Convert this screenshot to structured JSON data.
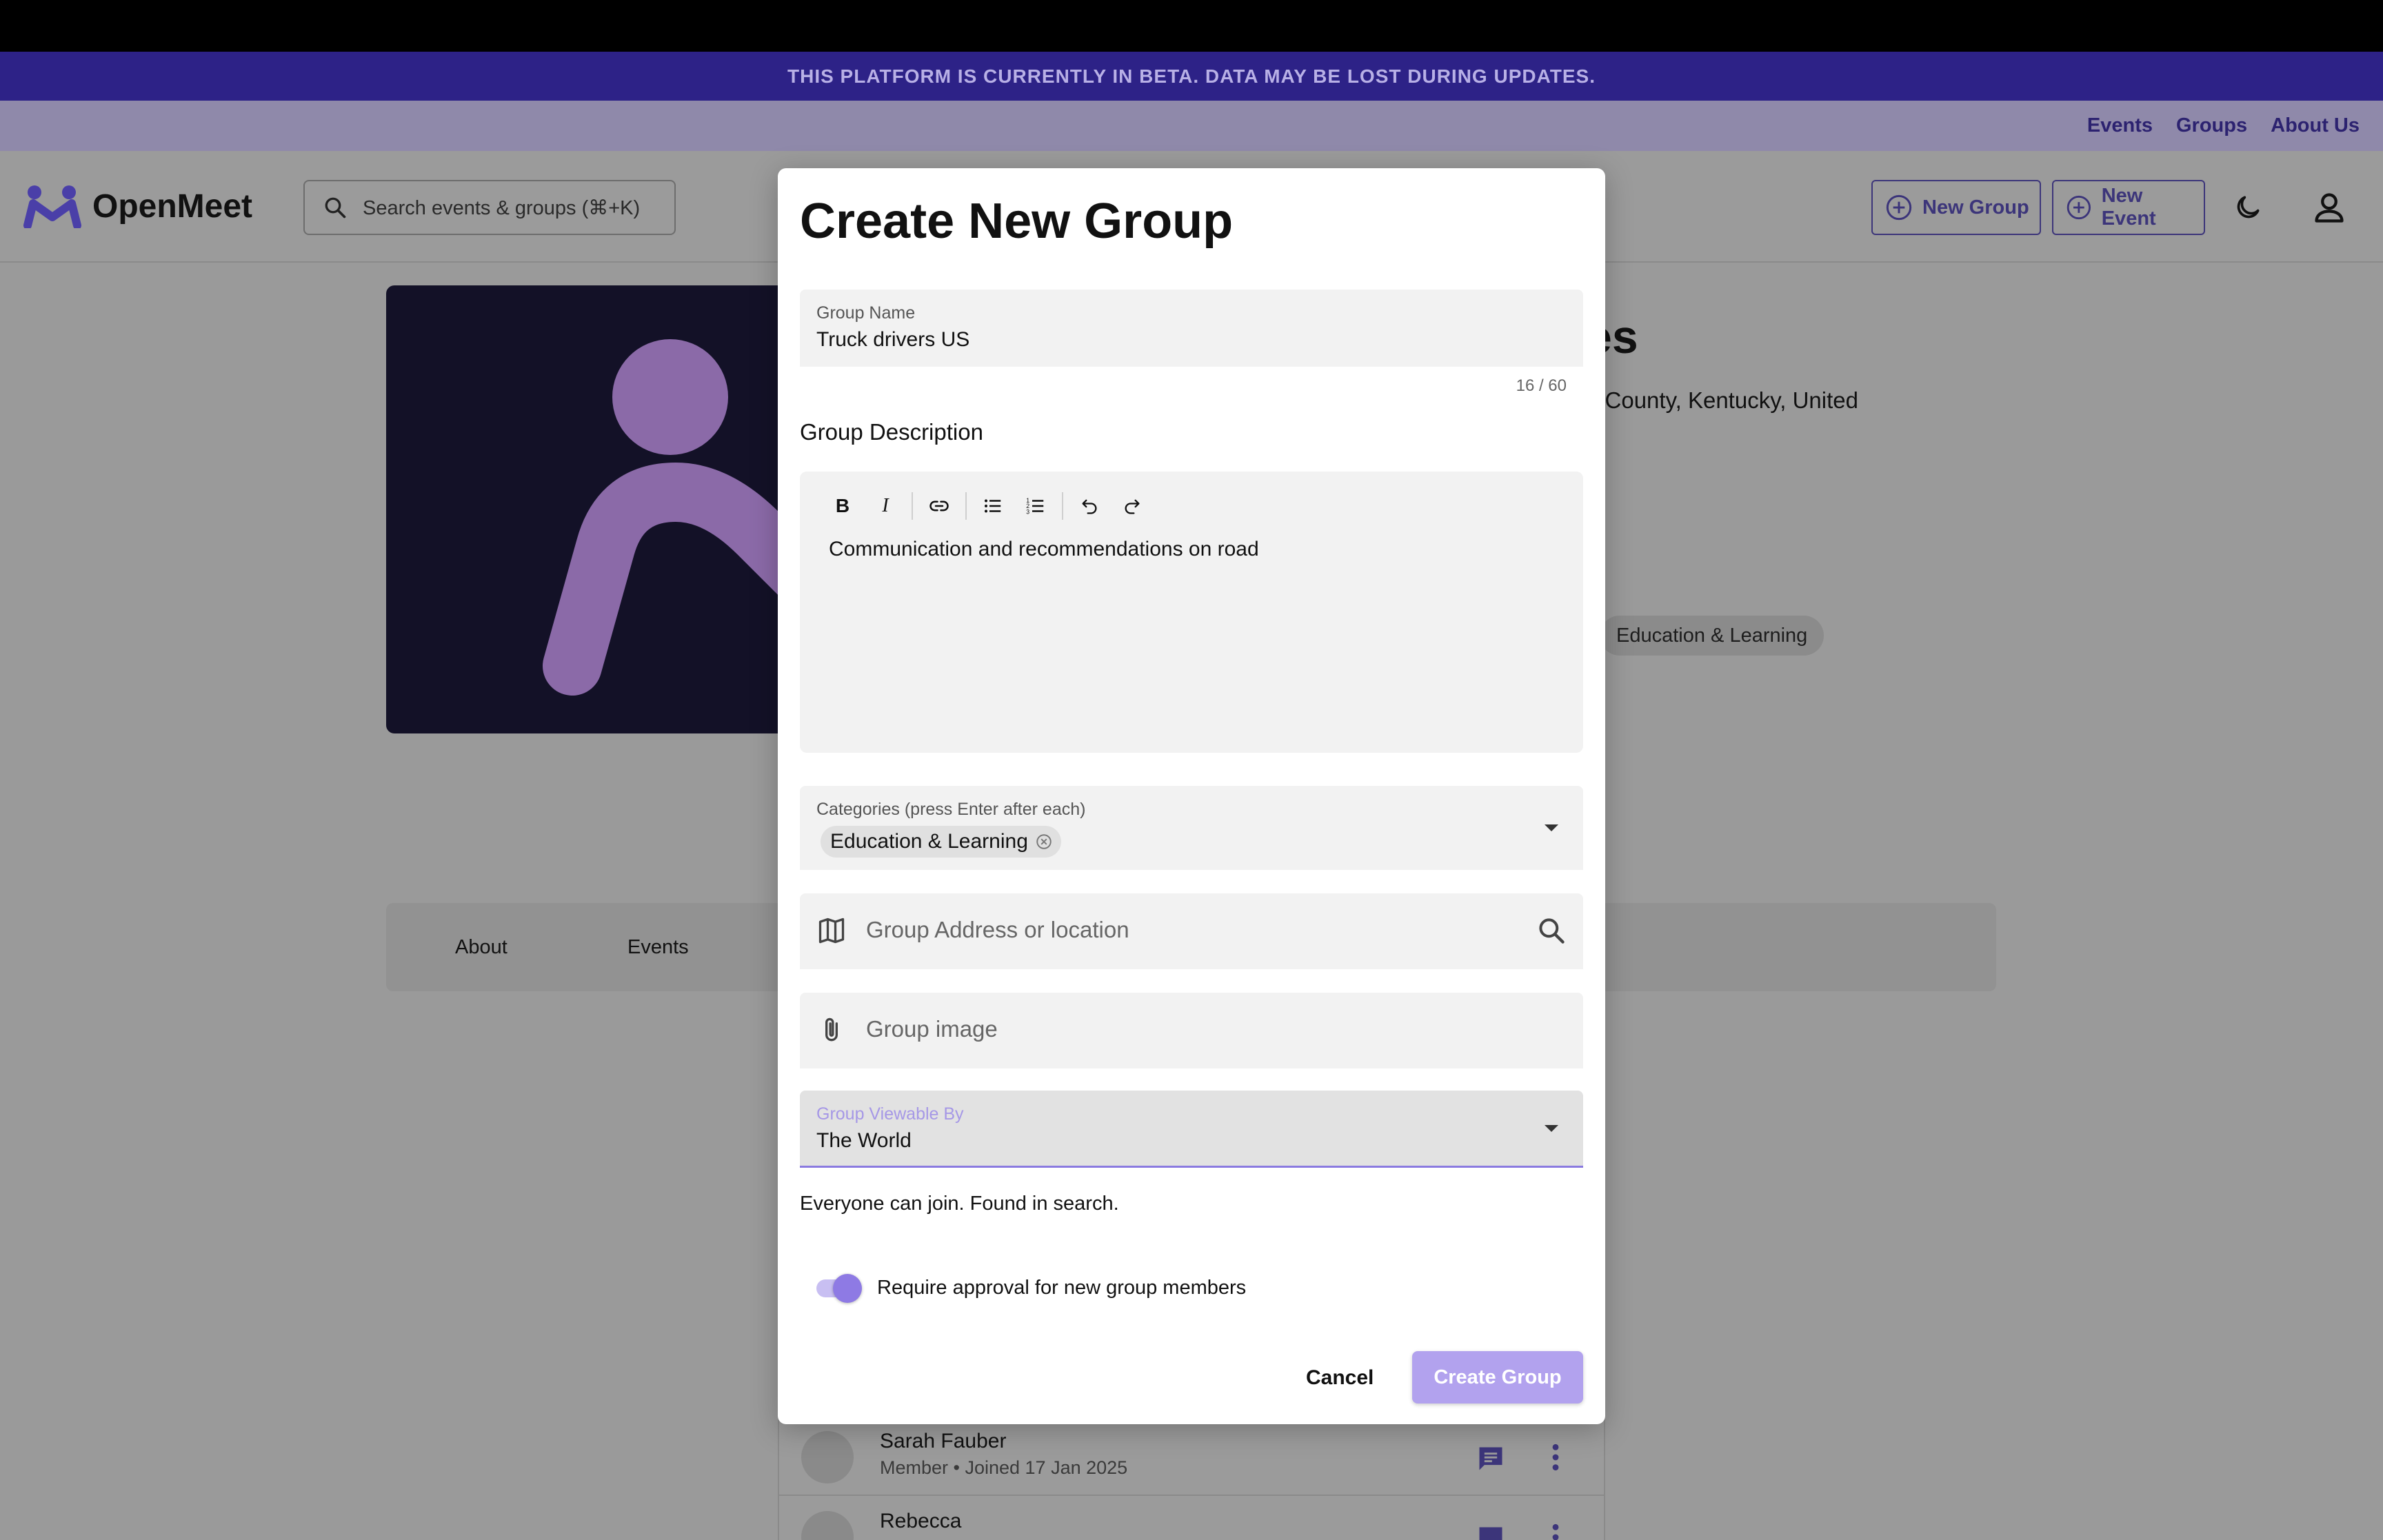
{
  "banner": {
    "text": "THIS PLATFORM IS CURRENTLY IN BETA. DATA MAY BE LOST DURING UPDATES."
  },
  "top_nav": {
    "links": [
      "Events",
      "Groups",
      "About Us"
    ]
  },
  "header": {
    "brand": "OpenMeet",
    "search_placeholder": "Search events & groups (⌘+K)",
    "new_group": "New Group",
    "new_event": "New Event"
  },
  "background": {
    "title_fragment": "es",
    "location_fragment": "n County, Kentucky, United",
    "category_chip": "Education & Learning",
    "tabs": [
      "About",
      "Events"
    ],
    "members": [
      {
        "name": "Sarah Fauber",
        "sub": "Member • Joined 17 Jan 2025"
      },
      {
        "name": "Rebecca",
        "sub": ""
      }
    ]
  },
  "modal": {
    "title": "Create New Group",
    "group_name": {
      "label": "Group Name",
      "value": "Truck drivers US",
      "counter": "16 / 60"
    },
    "description": {
      "label": "Group Description",
      "text": "Communication and recommendations on road"
    },
    "categories": {
      "label": "Categories (press Enter after each)",
      "chips": [
        "Education & Learning"
      ]
    },
    "address": {
      "placeholder": "Group Address or location"
    },
    "image": {
      "placeholder": "Group image"
    },
    "viewable": {
      "label": "Group Viewable By",
      "value": "The World",
      "hint": "Everyone can join. Found in search."
    },
    "approval": {
      "label": "Require approval for new group members",
      "enabled": true
    },
    "cancel": "Cancel",
    "create": "Create Group"
  },
  "colors": {
    "accent": "#8e7ae4",
    "banner": "#2d2287",
    "primary_button": "#b2a2ee"
  }
}
